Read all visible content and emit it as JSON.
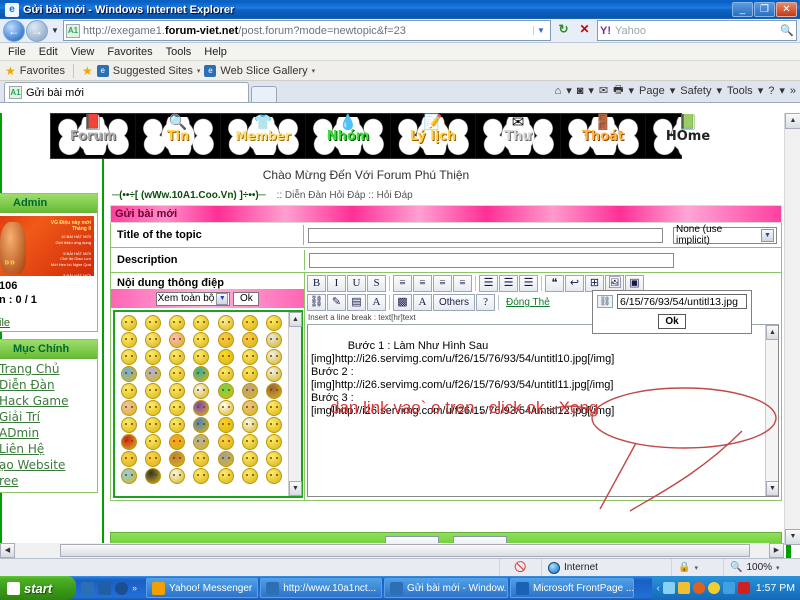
{
  "window": {
    "title": "Gửi bài mới - Windows Internet Explorer",
    "minimize": "_",
    "maximize": "❐",
    "close": "✕"
  },
  "address_bar": {
    "favicon_text": "A1",
    "url_prefix": "http://exegame1.",
    "url_domain": "forum-viet.net",
    "url_suffix": "/post.forum?mode=newtopic&f=23",
    "dropdown_icon": "▼",
    "refresh_icon": "↻",
    "stop_icon": "✕",
    "search_provider": "Y!",
    "search_placeholder": "Yahoo",
    "search_icon": "🔍"
  },
  "menu_bar": [
    "File",
    "Edit",
    "View",
    "Favorites",
    "Tools",
    "Help"
  ],
  "favorites_bar": {
    "star_icon": "★",
    "favorites_label": "Favorites",
    "suggested_sites": "Suggested Sites",
    "web_slice_gallery": "Web Slice Gallery",
    "caret": "▾"
  },
  "tab": {
    "favicon_text": "A1",
    "label": "Gửi bài mới"
  },
  "command_bar": {
    "home_icon": "⌂",
    "feeds_icon": "◙",
    "read_mail_icon": "✉",
    "print_icon": "🖶",
    "page": "Page",
    "safety": "Safety",
    "tools": "Tools",
    "help_icon": "?",
    "overflow": "»",
    "caret": "▾"
  },
  "forum": {
    "nav_buttons": [
      {
        "label": "Forum",
        "color": "#c8c8c8",
        "deco": "📕"
      },
      {
        "label": "Tin",
        "color": "#ffd24a",
        "deco": "🔍"
      },
      {
        "label": "Member",
        "color": "#ffe07a",
        "deco": "👕"
      },
      {
        "label": "Nhóm",
        "color": "#44e044",
        "deco": "💧"
      },
      {
        "label": "Lý lịch",
        "color": "#ffd24a",
        "deco": "📝"
      },
      {
        "label": "Thư",
        "color": "#e0e0e0",
        "deco": "✉"
      },
      {
        "label": "Thoát",
        "color": "#ffb84a",
        "deco": "🚪"
      },
      {
        "label": "HOme",
        "color": "#ffffff",
        "deco": "📗"
      }
    ],
    "welcome": "Chào Mừng Đến Với Forum Phú Thiện",
    "breadcrumb_site": "─(••÷[ (wWw.10A1.Coo.Vn) ]÷••)─",
    "breadcrumb_path": ":: Diễn Đàn Hỏi Đáp :: Hỏi Đáp"
  },
  "sidebar": {
    "admin_panel": {
      "title": "Admin",
      "banner_headline": "VG Điệu này mới\\nTháng 9",
      "banner_lines": "10 BÀI HÁT MỚI\\nGiới thiệu ứng dụng\\n\\n9 BÀI HÁT MỚI\\nChế độ Giao Lưu\\nMới Hẹn hò Nghe Quá\\n\\n8 BÀI HÁT MỚI\\nChế độ Guitar\\n\\n10 BÀI HÁT MỚI\\nChế độ Space Pong Pong",
      "count": "106",
      "ratio_label": "n :",
      "ratio": "0 / 1",
      "profile_link": "ile"
    },
    "main_menu": {
      "title": "Mục Chính",
      "items": [
        "Trang Chủ",
        "Diễn Đàn",
        "Hack Game",
        "Giải Trí",
        "ADmin",
        "Liên Hệ",
        "ạo Website",
        "ree"
      ]
    }
  },
  "form": {
    "header": "Gửi bài mới",
    "title_label": "Title of the topic",
    "title_value": "",
    "icon_select_value": "None (use implicit)",
    "description_label": "Description",
    "description_value": "",
    "message_label": "Nội dung thông điệp"
  },
  "smiley_panel": {
    "select_value": "Xem toàn bộ",
    "ok_label": "Ok",
    "rows": 10,
    "cols": 7
  },
  "editor": {
    "toolbar_row1": [
      {
        "name": "bold-button",
        "label": "B"
      },
      {
        "name": "italic-button",
        "label": "I"
      },
      {
        "name": "underline-button",
        "label": "U"
      },
      {
        "name": "strikethrough-button",
        "label": "S"
      },
      {
        "name": "align-left-button",
        "label": "≡"
      },
      {
        "name": "align-center-button",
        "label": "≡"
      },
      {
        "name": "align-right-button",
        "label": "≡"
      },
      {
        "name": "justify-button",
        "label": "≡"
      },
      {
        "name": "bullet-list-button",
        "label": "☰"
      },
      {
        "name": "numbered-list-button",
        "label": "☰"
      },
      {
        "name": "indent-button",
        "label": "☰"
      },
      {
        "name": "quote-button",
        "label": "❝"
      },
      {
        "name": "code-button",
        "label": "↩"
      },
      {
        "name": "table-button",
        "label": "⊞"
      },
      {
        "name": "insert-image-button",
        "label": "🖼"
      },
      {
        "name": "flash-button",
        "label": "▣"
      }
    ],
    "toolbar_row2": [
      {
        "name": "insert-link-button",
        "label": "⛓"
      },
      {
        "name": "highlight-button",
        "label": "✎"
      },
      {
        "name": "color-bar-button",
        "label": "▤"
      },
      {
        "name": "font-color-button",
        "label": "A"
      },
      {
        "name": "font-bg-button",
        "label": "▩"
      },
      {
        "name": "font-style-button",
        "label": "A"
      },
      {
        "name": "others-button",
        "label": "Others"
      },
      {
        "name": "help-button",
        "label": "?"
      }
    ],
    "close_tag_label": "Đóng Thẻ",
    "hint": "Insert a line break : text[hr]text",
    "message_value": "Bước 1 : Làm Như Hình Sau\n[img]http://i26.servimg.com/u/f26/15/76/93/54/untitl10.jpg[/img]\nBước 2 :\n[img]http://i26.servimg.com/u/f26/15/76/93/54/untitl11.jpg[/img]\nBước 3 :\n[img]http://i26.servimg.com/u/f26/15/76/93/54/untitl12.jpg[/img]"
  },
  "link_popup": {
    "chain_icon": "⛓",
    "url_value": "6/15/76/93/54/untitl13.jpg",
    "ok_label": "Ok"
  },
  "annotation": {
    "text": "dan link vao` o tren . click ok . Xong",
    "color": "#d23a3a"
  },
  "status_bar": {
    "zone_label": "Internet",
    "zoom_label": "100%",
    "zoom_icon": "🔍",
    "protect_icon": "🔒",
    "blocked_icon": "🚫",
    "caret": "▾"
  },
  "taskbar": {
    "start_label": "start",
    "quick_launch": [
      "ie-icon",
      "mail-icon",
      "media-icon",
      "overflow-chevron"
    ],
    "overflow_label": "»",
    "tasks": [
      {
        "name": "task-yahoo-messenger",
        "label": "Yahoo! Messenger",
        "icon_color": "#f0a000"
      },
      {
        "name": "task-ie-10a1nct",
        "label": "http://www.10a1nct...",
        "icon_color": "#2d6fb5"
      },
      {
        "name": "task-ie-guibaimoi",
        "label": "Gửi bài mới - Window...",
        "icon_color": "#2d6fb5"
      },
      {
        "name": "task-frontpage",
        "label": "Microsoft FrontPage ...",
        "icon_color": "#1a62b5"
      }
    ],
    "tray_icons": [
      "#8ad0f0",
      "#f0c030",
      "#e06020",
      "#f0d030",
      "#40a0e0",
      "#d02020"
    ],
    "time": "1:57 PM",
    "show_hide_icon": "‹"
  }
}
